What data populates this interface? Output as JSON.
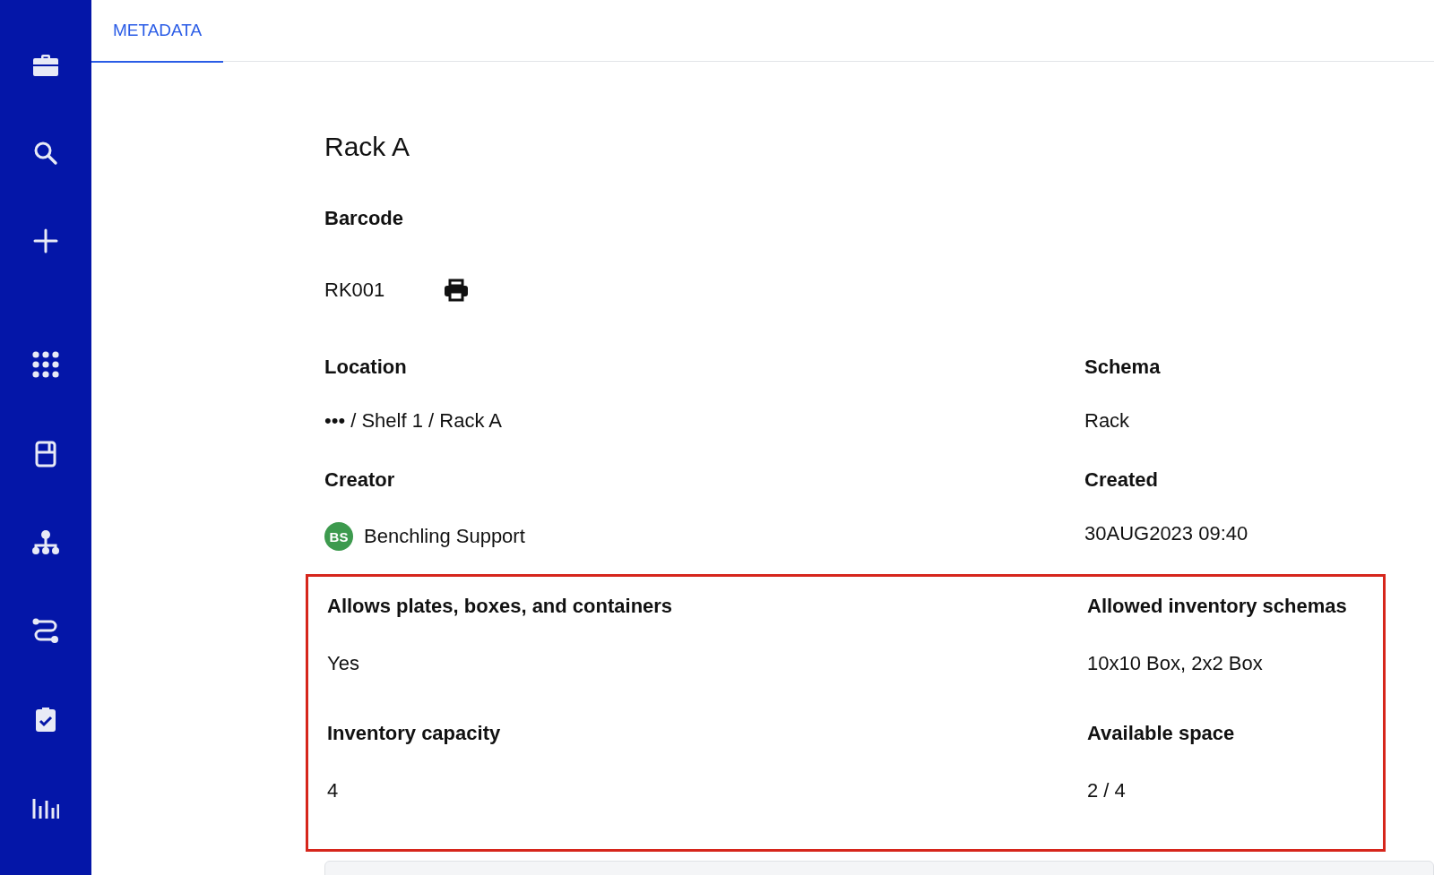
{
  "tabs": [
    {
      "label": "METADATA",
      "selected": true
    }
  ],
  "title": "Rack A",
  "fields": [
    {
      "kind": "barcode",
      "label": "Barcode",
      "value": "RK001"
    },
    {
      "kind": "blank"
    },
    {
      "kind": "text",
      "label": "Location",
      "value": "••• / Shelf 1 / Rack A"
    },
    {
      "kind": "text",
      "label": "Schema",
      "value": "Rack"
    },
    {
      "kind": "user",
      "label": "Creator",
      "value": "Benchling Support",
      "initials": "BS",
      "color": "#3d9a4e"
    },
    {
      "kind": "text",
      "label": "Created",
      "value": "30AUG2023 09:40"
    }
  ],
  "highlighted_fields": [
    {
      "kind": "text",
      "label": "Allows plates, boxes, and containers",
      "value": "Yes"
    },
    {
      "kind": "text",
      "label": "Allowed inventory schemas",
      "value": "10x10 Box, 2x2 Box"
    },
    {
      "kind": "text",
      "label": "Inventory capacity",
      "value": "4"
    },
    {
      "kind": "text",
      "label": "Available space",
      "value": "2 / 4"
    }
  ]
}
